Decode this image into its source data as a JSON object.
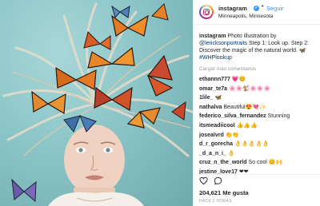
{
  "post": {
    "username": "instagram",
    "verified_badge": "✔",
    "separator": "•",
    "follow_label": "Seguir",
    "location": "Minneapolis, Minnesota"
  },
  "caption": {
    "username": "instagram",
    "text_before": " Photo illustration by ",
    "mention": "@lericksonportraits",
    "text_after": " Step 1: Look up. Step 2: Discover the magic of the natural world. 🦋 ",
    "hashtag": "#WHPlookup"
  },
  "load_more": "Cargar más comentarios",
  "comments": [
    {
      "user": "ethannn777",
      "text": " 💗😊"
    },
    {
      "user": "omar_te7a",
      "text": " 🌸🌸🐒🌸🌸🌸"
    },
    {
      "user": "1lile_",
      "text": " 🦋"
    },
    {
      "user": "nathalva",
      "text": " Beautiful😍💘✨"
    },
    {
      "user": "federico_silva_fernandez",
      "text": " Stunning"
    },
    {
      "user": "itsmeadiicool",
      "text": " 👍👍👍"
    },
    {
      "user": "josealvrd",
      "text": " 👏👏"
    },
    {
      "user": "d_r_gorecha",
      "text": " 👌👌👌👌👌"
    },
    {
      "user": "_d_a_n_i_",
      "text": " 👌"
    },
    {
      "user": "cruz_n_the_world",
      "text": " So cool 😊🙌"
    },
    {
      "user": "jestine_love17",
      "text": " ❤❤"
    }
  ],
  "likes": "204,621 Me gusta",
  "timestamp": "HACE 2 HORAS",
  "icons": {
    "avatar": "instagram-logo-icon",
    "like": "heart-icon",
    "comment": "comment-bubble-icon"
  },
  "colors": {
    "link": "#003569",
    "follow": "#3897f0",
    "muted": "#999999"
  }
}
